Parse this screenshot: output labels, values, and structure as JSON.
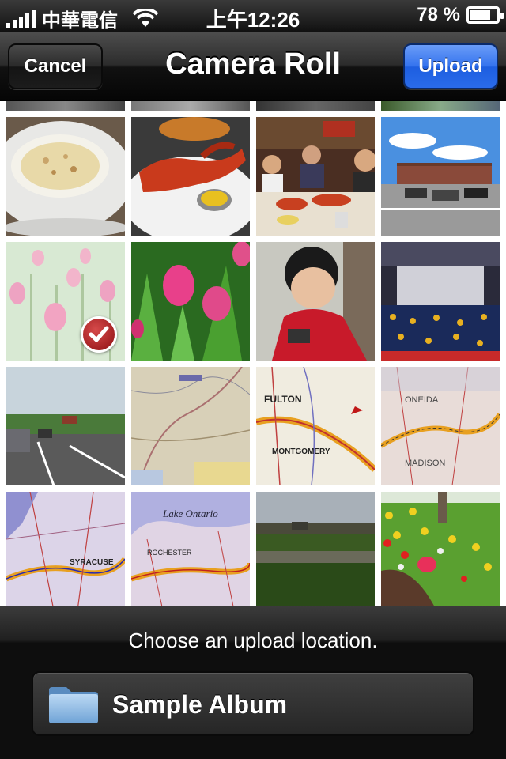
{
  "status_bar": {
    "carrier": "中華電信",
    "time": "上午12:26",
    "battery": "78 %",
    "battery_level": 0.78
  },
  "nav": {
    "title": "Camera Roll",
    "cancel_label": "Cancel",
    "upload_label": "Upload"
  },
  "photos": [
    {
      "subject": "clam-chowder",
      "selected": false
    },
    {
      "subject": "lobster",
      "selected": false
    },
    {
      "subject": "family-dinner",
      "selected": false
    },
    {
      "subject": "campus-building",
      "selected": false
    },
    {
      "subject": "pink-tulips",
      "selected": true
    },
    {
      "subject": "tulips-closeup",
      "selected": false
    },
    {
      "subject": "boy-with-phone",
      "selected": false
    },
    {
      "subject": "graduation-ceremony",
      "selected": false
    },
    {
      "subject": "parking-lot",
      "selected": false
    },
    {
      "subject": "map",
      "selected": false
    },
    {
      "subject": "map-fulton",
      "selected": false
    },
    {
      "subject": "map-oneida",
      "selected": false
    },
    {
      "subject": "map-syracuse",
      "selected": false
    },
    {
      "subject": "map-lake-ontario",
      "selected": false
    },
    {
      "subject": "field",
      "selected": false
    },
    {
      "subject": "flower-garden",
      "selected": false
    }
  ],
  "bottom": {
    "prompt": "Choose an upload location.",
    "album_label": "Sample Album"
  },
  "colors": {
    "upload_accent": "#2a6bea",
    "check_badge": "#b52226"
  }
}
